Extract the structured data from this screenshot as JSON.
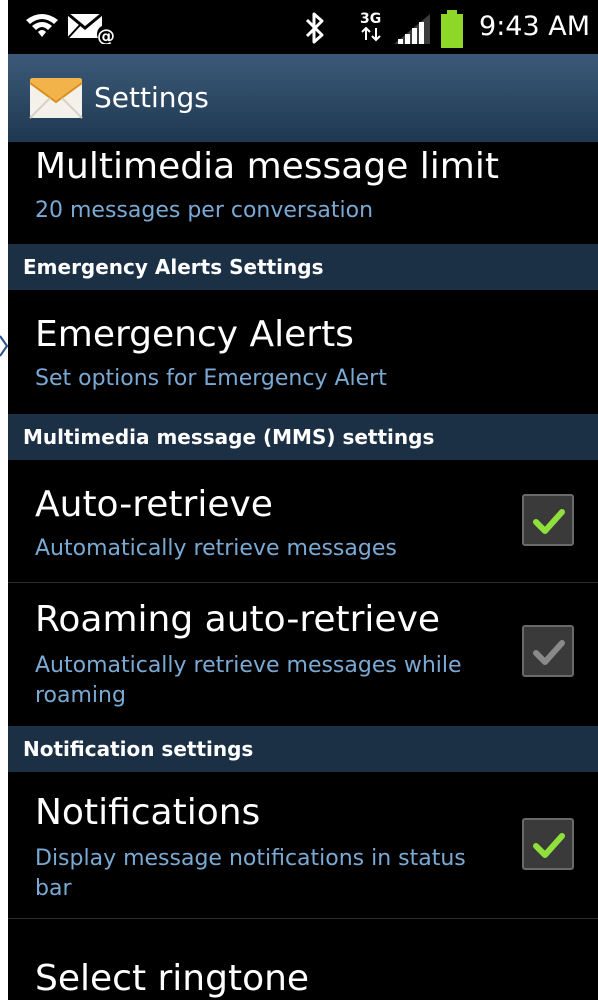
{
  "status_bar": {
    "time": "9:43 AM",
    "network_type": "3G",
    "icons": [
      "wifi-icon",
      "email-notification-icon",
      "bluetooth-icon",
      "3g-data-icon",
      "signal-strength-icon",
      "battery-icon"
    ],
    "battery_color": "#8ed628"
  },
  "title_bar": {
    "title": "Settings",
    "icon": "envelope-icon"
  },
  "colors": {
    "background": "#000000",
    "summary_text": "#7aaad4",
    "section_header_bg": "#1c3045",
    "check_enabled": "#8fe03c",
    "check_disabled": "#8a8a8a"
  },
  "items": {
    "mms_limit": {
      "title": "Multimedia message limit",
      "summary": "20 messages per conversation"
    },
    "emergency_alerts": {
      "title": "Emergency Alerts",
      "summary": "Set options for Emergency Alert"
    },
    "auto_retrieve": {
      "title": "Auto-retrieve",
      "summary": "Automatically retrieve messages",
      "checked": true,
      "enabled": true
    },
    "roaming_auto_retrieve": {
      "title": "Roaming auto-retrieve",
      "summary": "Automatically retrieve messages while roaming",
      "checked": true,
      "enabled": false
    },
    "notifications": {
      "title": "Notifications",
      "summary": "Display message notifications in status bar",
      "checked": true,
      "enabled": true
    },
    "select_ringtone": {
      "title": "Select ringtone"
    }
  },
  "sections": {
    "emergency": "Emergency Alerts Settings",
    "mms": "Multimedia message (MMS) settings",
    "notification": "Notification settings"
  }
}
